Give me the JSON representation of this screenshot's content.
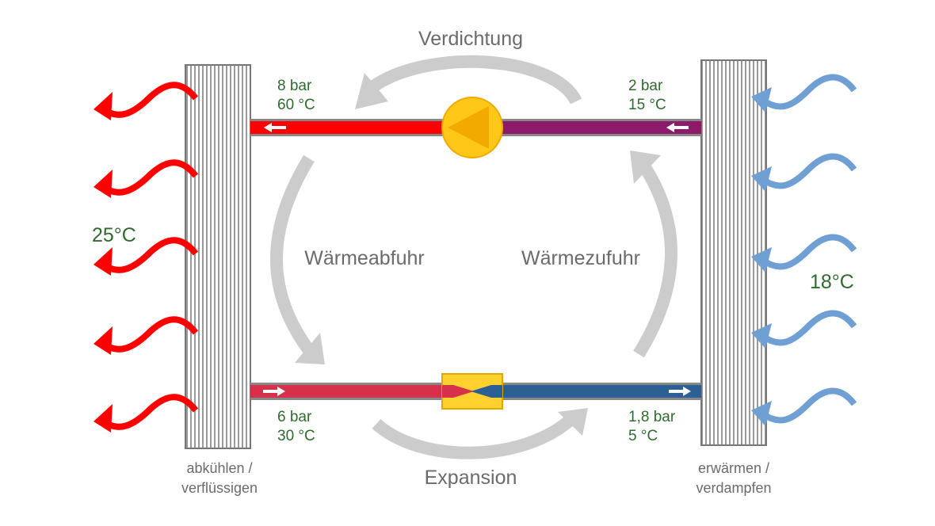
{
  "labels": {
    "compression": "Verdichtung",
    "expansion": "Expansion",
    "heat_release": "Wärmeabfuhr",
    "heat_intake": "Wärmezufuhr",
    "condenser_line1": "abkühlen /",
    "condenser_line2": "verflüssigen",
    "evaporator_line1": "erwärmen /",
    "evaporator_line2": "verdampfen"
  },
  "states": {
    "high_pressure_hot": {
      "pressure": "8 bar",
      "temperature": "60 °C"
    },
    "low_pressure_after_evaporator": {
      "pressure": "2 bar",
      "temperature": "15 °C"
    },
    "high_pressure_liquid": {
      "pressure": "6 bar",
      "temperature": "30 °C"
    },
    "after_expansion": {
      "pressure": "1,8 bar",
      "temperature": "5 °C"
    }
  },
  "room_temperatures": {
    "left": "25°C",
    "right": "18°C"
  },
  "colors": {
    "hot_gas": "#ff0000",
    "suction_gas": "#8b1a6b",
    "liquid_warm": "#d7304b",
    "liquid_cold": "#2c5f94",
    "compressor": "#ffc819",
    "expansion_valve": "#ffd12e",
    "heat_out_arrow": "#ff0000",
    "heat_in_arrow": "#6f9fd3",
    "cycle_arrow": "#cccccc",
    "label_gray": "#6b6b6b",
    "label_green": "#2f6b2f"
  },
  "icons": {
    "compressor": "triangle-play-icon",
    "expansion_valve": "valve-icon",
    "flow_direction": "small-arrow-icon",
    "heat_flow": "wavy-arrow-icon"
  }
}
